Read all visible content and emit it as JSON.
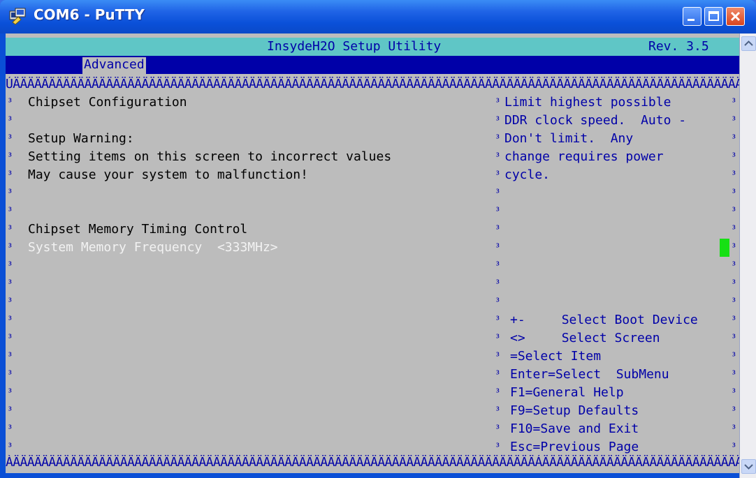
{
  "window": {
    "title": "COM6 - PuTTY"
  },
  "bios": {
    "header_title": "InsydeH2O Setup Utility",
    "header_rev": "Rev. 3.5",
    "tabs": [
      {
        "label": "Advanced"
      }
    ],
    "border_top": "ÚÄÄÄÄÄÄÄÄÄÄÄÄÄÄÄÄÄÄÄÄÄÄÄÄÄÄÄÄÄÄÄÄÄÄÄÄÄÄÄÄÄÄÄÄÄÄÄÄÄÄÄÄÄÄÄÄÄÄÄÄÄÄÄÄÄÄÄÄÄÄÄÄÄÂÄÄÄÄÄÄÄÄÄÄÄÄÄÄÄÄÄÄÄÄÄÄÄÄÄÄÄÄÄ¿",
    "border_bottom": "ÀÄÄÄÄÄÄÄÄÄÄÄÄÄÄÄÄÄÄÄÄÄÄÄÄÄÄÄÄÄÄÄÄÄÄÄÄÄÄÄÄÄÄÄÄÄÄÄÄÄÄÄÄÄÄÄÄÄÄÄÄÄÄÄÄÄÄÄÄÄÄÄÄÄÁÄÄÄÄÄÄÄÄÄÄÄÄÄÄÄÄÄÄÄÄÄÄÄÄÄÄÄÄÄÙ",
    "left": {
      "section_title": "Chipset Configuration",
      "warning_title": "Setup Warning:",
      "warning_line1": "Setting items on this screen to incorrect values",
      "warning_line2": "May cause your system to malfunction!",
      "timing_control": "Chipset Memory Timing Control",
      "mem_freq_label": "System Memory Frequency",
      "mem_freq_value": "<333MHz>"
    },
    "help": {
      "line1": "Limit highest possible",
      "line2": "DDR clock speed.  Auto -",
      "line3": "Don't limit.  Any",
      "line4": "change requires power",
      "line5": "cycle."
    },
    "keys": [
      {
        "key": "+-",
        "action": "Select Boot Device"
      },
      {
        "key": "<>",
        "action": "Select Screen"
      },
      {
        "text": "=Select Item"
      },
      {
        "text": "Enter=Select  SubMenu"
      },
      {
        "text": "F1=General Help"
      },
      {
        "text": "F9=Setup Defaults"
      },
      {
        "text": "F10=Save and Exit"
      },
      {
        "text": "Esc=Previous Page"
      }
    ],
    "side_marker": "³"
  }
}
